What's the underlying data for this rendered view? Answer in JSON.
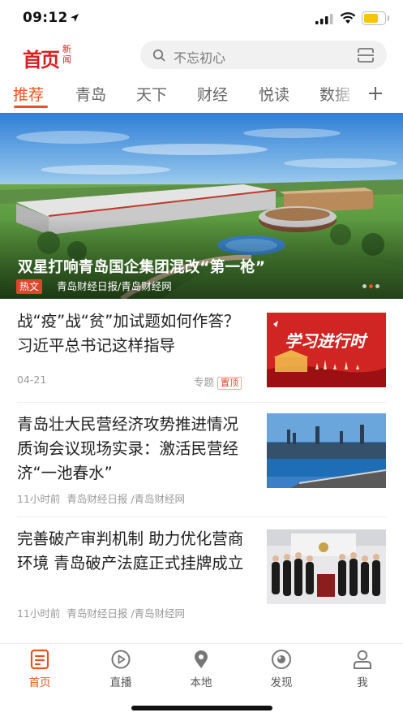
{
  "status_bar": {
    "time": "09:12"
  },
  "header": {
    "logo_main": "首页",
    "logo_sub": "新闻",
    "search_placeholder": "不忘初心"
  },
  "tabs": [
    {
      "label": "推荐",
      "active": true
    },
    {
      "label": "青岛",
      "active": false
    },
    {
      "label": "天下",
      "active": false
    },
    {
      "label": "财经",
      "active": false
    },
    {
      "label": "悦读",
      "active": false
    },
    {
      "label": "数据",
      "active": false
    }
  ],
  "banner": {
    "title": "双星打响青岛国企集团混改“第一枪”",
    "tag": "热文",
    "source": "青岛财经日报/青岛财经网"
  },
  "articles": [
    {
      "title": "战“疫”战“贫”加试题如何作答？习近平总书记这样指导",
      "date": "04-21",
      "category": "专题",
      "badge": "置顶",
      "thumb_text": "学习进行时"
    },
    {
      "title": "青岛壮大民营经济攻势推进情况质询会议现场实录：激活民营经济“一池春水”",
      "time": "11小时前",
      "source": "青岛财经日报 /青岛财经网"
    },
    {
      "title": "完善破产审判机制 助力优化营商环境  青岛破产法庭正式挂牌成立",
      "time": "11小时前",
      "source": "青岛财经日报 /青岛财经网"
    }
  ],
  "bottom_nav": [
    {
      "label": "首页",
      "icon": "news-icon",
      "active": true
    },
    {
      "label": "直播",
      "icon": "play-icon",
      "active": false
    },
    {
      "label": "本地",
      "icon": "location-pin-icon",
      "active": false
    },
    {
      "label": "发现",
      "icon": "eye-icon",
      "active": false
    },
    {
      "label": "我",
      "icon": "user-icon",
      "active": false
    }
  ],
  "colors": {
    "accent": "#e8541d",
    "logo_red": "#d81e1e",
    "tag_red": "#d9482a"
  }
}
